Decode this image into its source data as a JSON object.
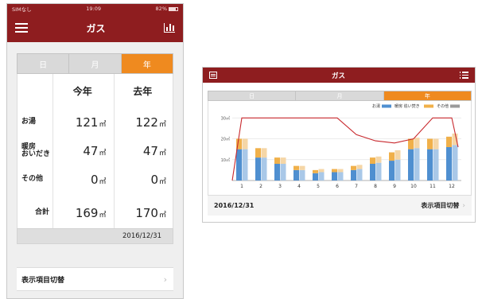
{
  "phone": {
    "status": {
      "carrier": "SIMなし",
      "time": "19:09",
      "battery": "82%"
    },
    "title": "ガス",
    "tabs": [
      {
        "label": "日"
      },
      {
        "label": "月"
      },
      {
        "label": "年",
        "active": true
      }
    ],
    "table": {
      "col_this_year": "今年",
      "col_last_year": "去年",
      "unit": "㎥",
      "rows": [
        {
          "label": "お湯",
          "this_year": "121",
          "last_year": "122"
        },
        {
          "label_line1": "暖房",
          "label_line2": "おいだき",
          "this_year": "47",
          "last_year": "47"
        },
        {
          "label": "その他",
          "this_year": "0",
          "last_year": "0"
        },
        {
          "label": "合計",
          "this_year": "169",
          "last_year": "170"
        }
      ]
    },
    "date": "2016/12/31",
    "switch_label": "表示項目切替"
  },
  "tablet": {
    "title": "ガス",
    "tabs": [
      {
        "label": "日"
      },
      {
        "label": "月"
      },
      {
        "label": "年",
        "active": true
      }
    ],
    "date": "2016/12/31",
    "switch_label": "表示項目切替"
  },
  "colors": {
    "header": "#8e1d1f",
    "accent": "#ef8a1f",
    "hot_water": "#4f8fd0",
    "hot_water_last": "#a9c8e8",
    "heating": "#f0b04a",
    "heating_last": "#f5d6a6",
    "other": "#9a9a9a",
    "line": "#c8282d"
  },
  "chart_data": {
    "type": "bar",
    "categories": [
      "1",
      "2",
      "3",
      "4",
      "5",
      "6",
      "7",
      "8",
      "9",
      "10",
      "11",
      "12"
    ],
    "yticks": [
      "10㎥",
      "20㎥",
      "30㎥"
    ],
    "ylim": [
      0,
      32
    ],
    "legend_position": "top-right",
    "legend": [
      {
        "label": "お湯",
        "color": "#4f8fd0"
      },
      {
        "label": "暖房 追い焚き",
        "color": "#f0b04a"
      },
      {
        "label": "その他",
        "color": "#9a9a9a"
      }
    ],
    "series": [
      {
        "name": "お湯",
        "group": "this_year",
        "values": [
          15,
          11,
          8,
          5,
          3.5,
          4,
          5,
          8,
          9.5,
          15,
          15,
          16
        ]
      },
      {
        "name": "暖房 追い焚き",
        "group": "this_year",
        "values": [
          5,
          4.5,
          3,
          2,
          1.5,
          1.5,
          2,
          3,
          4,
          5,
          5,
          5
        ]
      },
      {
        "name": "お湯",
        "group": "last_year",
        "values": [
          15,
          11,
          8,
          5,
          4,
          4,
          5.5,
          8.5,
          10,
          15.5,
          15,
          17
        ]
      },
      {
        "name": "暖房 追い焚き",
        "group": "last_year",
        "values": [
          5,
          4.5,
          3,
          2,
          1.5,
          1.5,
          2,
          3,
          4.5,
          5,
          5,
          5.5
        ]
      }
    ],
    "line": {
      "x": [
        0.6,
        1,
        2,
        3,
        4,
        5,
        6,
        7,
        8,
        9,
        10,
        11,
        12
      ],
      "values": [
        0,
        30,
        30,
        30,
        30,
        30,
        30,
        22,
        19,
        18,
        20,
        30,
        30,
        16
      ]
    }
  }
}
